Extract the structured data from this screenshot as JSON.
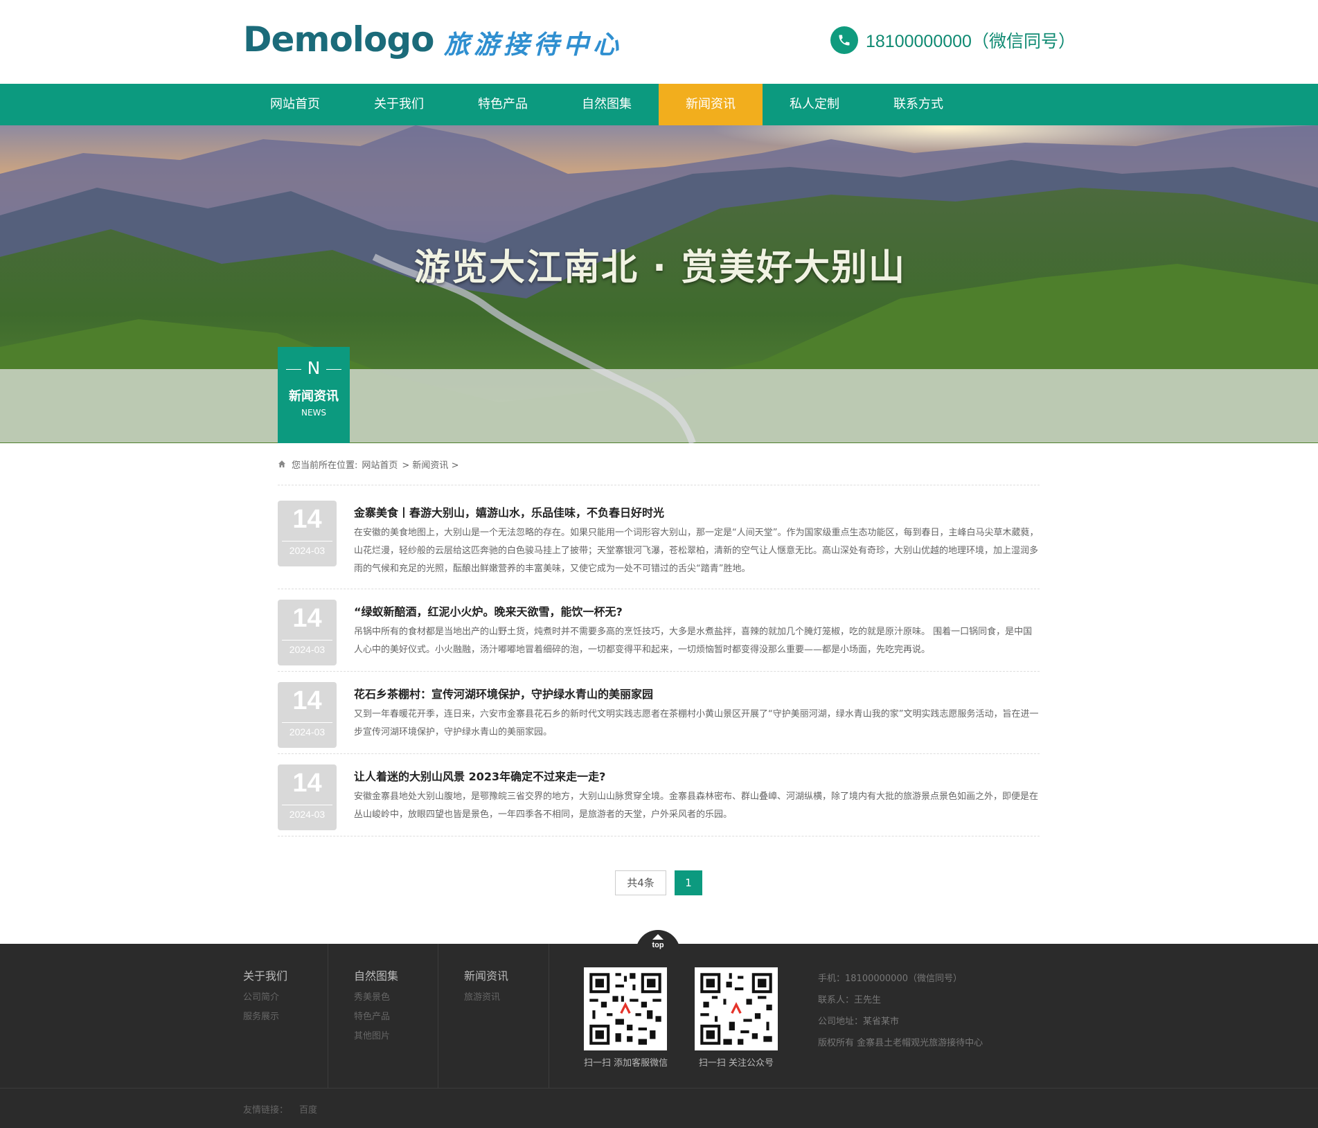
{
  "header": {
    "logo_text": "Demologo",
    "slogan": "旅游接待中心",
    "phone": "18100000000（微信同号）"
  },
  "nav": {
    "items": [
      {
        "label": "网站首页"
      },
      {
        "label": "关于我们"
      },
      {
        "label": "特色产品"
      },
      {
        "label": "自然图集"
      },
      {
        "label": "新闻资讯"
      },
      {
        "label": "私人定制"
      },
      {
        "label": "联系方式"
      }
    ],
    "active_index": 4
  },
  "banner": {
    "title": "游览大江南北 · 赏美好大别山"
  },
  "section": {
    "letter": "N",
    "title": "新闻资讯",
    "subtitle": "NEWS"
  },
  "breadcrumb": {
    "prefix": "您当前所在位置:",
    "home": "网站首页",
    "current": "> 新闻资讯 >"
  },
  "news": [
    {
      "day": "14",
      "ym": "2024-03",
      "title": "金寨美食丨春游大别山，嬉游山水，乐品佳味，不负春日好时光",
      "desc": "在安徽的美食地图上，大别山是一个无法忽略的存在。如果只能用一个词形容大别山，那一定是“人间天堂”。作为国家级重点生态功能区，每到春日，主峰白马尖草木葳蕤，山花烂漫，轻纱般的云层给这匹奔驰的白色骏马挂上了披带；天堂寨银河飞瀑，苍松翠柏，清新的空气让人惬意无比。高山深处有奇珍，大别山优越的地理环境，加上湿润多雨的气候和充足的光照，酝酿出鲜嫩营养的丰富美味，又使它成为一处不可错过的舌尖“踏青”胜地。"
    },
    {
      "day": "14",
      "ym": "2024-03",
      "title": "“绿蚁新醅酒，红泥小火炉。晚来天欲雪，能饮一杯无?",
      "desc": "吊锅中所有的食材都是当地出产的山野土货，炖煮时并不需要多高的烹饪技巧，大多是水煮盐拌，喜辣的就加几个腌灯笼椒，吃的就是原汁原味。 围着一口锅同食，是中国人心中的美好仪式。小火融融，汤汁嘟嘟地冒着细碎的泡，一切都变得平和起来，一切烦恼暂时都变得没那么重要——都是小场面，先吃完再说。"
    },
    {
      "day": "14",
      "ym": "2024-03",
      "title": "花石乡茶棚村：宣传河湖环境保护，守护绿水青山的美丽家园",
      "desc": "又到一年春暖花开季，连日来，六安市金寨县花石乡的新时代文明实践志愿者在茶棚村小黄山景区开展了“守护美丽河湖，绿水青山我的家”文明实践志愿服务活动，旨在进一步宣传河湖环境保护，守护绿水青山的美丽家园。"
    },
    {
      "day": "14",
      "ym": "2024-03",
      "title": "让人着迷的大别山风景 2023年确定不过来走一走?",
      "desc": "安徽金寨县地处大别山腹地，是鄂豫皖三省交界的地方，大别山山脉贯穿全境。金寨县森林密布、群山叠嶂、河湖纵横，除了境内有大批的旅游景点景色如画之外，即便是在丛山峻岭中，放眼四望也皆是景色，一年四季各不相同，是旅游者的天堂，户外采风者的乐园。"
    }
  ],
  "pagination": {
    "total": "共4条",
    "current": "1"
  },
  "footer": {
    "top_label": "top",
    "columns": [
      {
        "title": "关于我们",
        "links": [
          "公司简介",
          "服务展示"
        ]
      },
      {
        "title": "自然图集",
        "links": [
          "秀美景色",
          "特色产品",
          "其他图片"
        ]
      },
      {
        "title": "新闻资讯",
        "links": [
          "旅游资讯"
        ]
      }
    ],
    "qr": [
      {
        "caption": "扫一扫 添加客服微信"
      },
      {
        "caption": "扫一扫 关注公众号"
      }
    ],
    "info": {
      "phone": "手机：18100000000（微信同号）",
      "contact": "联系人：王先生",
      "address": "公司地址：某省某市",
      "copyright": "版权所有 金寨县土老帽观光旅游接待中心"
    },
    "links_label": "友情链接：",
    "links": [
      "百度"
    ]
  },
  "colors": {
    "brand": "#0c9a7f",
    "accent": "#f2ae1d",
    "footer_bg": "#2b2b2b"
  }
}
